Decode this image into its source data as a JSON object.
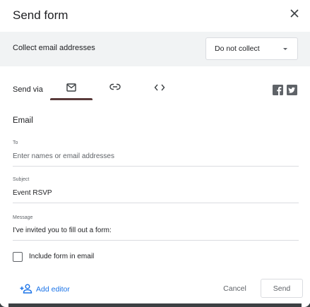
{
  "dialog": {
    "title": "Send form"
  },
  "collect": {
    "label": "Collect email addresses",
    "selected": "Do not collect"
  },
  "send_via": {
    "label": "Send via",
    "tabs": [
      {
        "icon": "email-icon",
        "active": true
      },
      {
        "icon": "link-icon",
        "active": false
      },
      {
        "icon": "embed-code-icon",
        "active": false
      }
    ],
    "social": [
      "facebook-icon",
      "twitter-icon"
    ]
  },
  "email": {
    "section_title": "Email",
    "to": {
      "label": "To",
      "placeholder": "Enter names or email addresses"
    },
    "subject": {
      "label": "Subject",
      "value": "Event RSVP"
    },
    "message": {
      "label": "Message",
      "value": "I've invited you to fill out a form:"
    },
    "include_form_label": "Include form in email"
  },
  "footer": {
    "add_editor": "Add editor",
    "cancel": "Cancel",
    "send": "Send"
  },
  "colors": {
    "accent_blue": "#1a73e8",
    "tab_underline": "#5a3b3b",
    "band": "#f1f3f4"
  }
}
